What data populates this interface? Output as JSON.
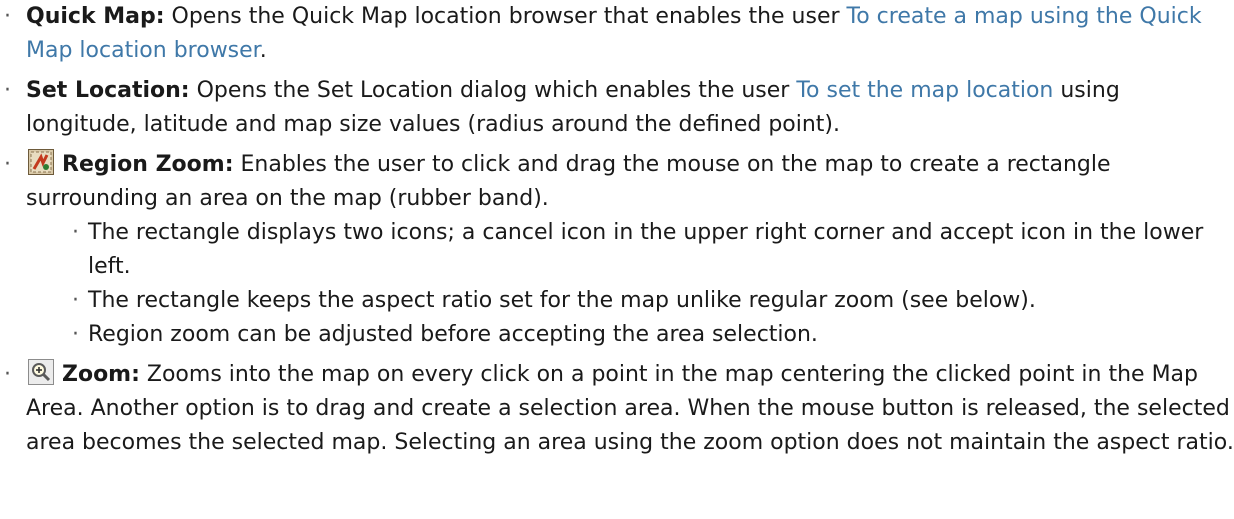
{
  "items": [
    {
      "term": "Quick Map:",
      "text_before": " Opens the Quick Map location browser that enables the user ",
      "link": "To create a map using the Quick Map location browser",
      "text_after": "."
    },
    {
      "term": "Set Location:",
      "text_before": " Opens the Set Location dialog which enables the user ",
      "link": "To set the map location",
      "text_after": " using longitude, latitude and map size values (radius around the defined point)."
    },
    {
      "icon": "region-zoom-icon",
      "term": "Region Zoom:",
      "text": " Enables the user to click and drag the mouse on the map to create a rectangle surrounding an area on the map (rubber band).",
      "sub": [
        "The rectangle displays two icons; a cancel icon in the upper right corner and accept icon in the lower left.",
        "The rectangle keeps the aspect ratio set for the map unlike regular zoom (see below).",
        "Region zoom can be adjusted before accepting the area selection."
      ]
    },
    {
      "icon": "zoom-icon",
      "term": "Zoom:",
      "text": " Zooms into the map on every click on a point in the map centering the clicked point in the Map Area. Another option is to drag and create a selection area. When the mouse button is released, the selected area becomes the selected map. Selecting an area using the zoom option does not maintain the aspect ratio."
    }
  ],
  "bullet_char": "·",
  "colors": {
    "link": "#3f78a8",
    "text": "#1a1a1a"
  }
}
